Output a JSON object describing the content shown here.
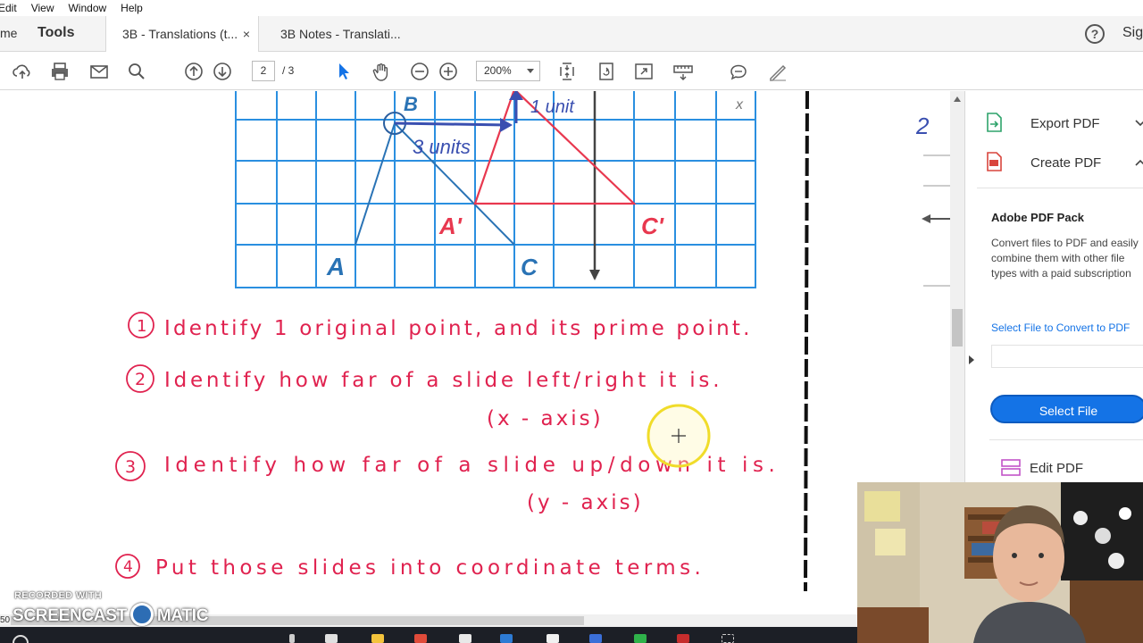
{
  "menu": {
    "items": [
      "Edit",
      "View",
      "Window",
      "Help"
    ]
  },
  "tabs": {
    "home_label": "me",
    "tools_label": "Tools",
    "doc_tabs": [
      {
        "label": "3B - Translations (t...",
        "close": "×"
      },
      {
        "label": "3B Notes - Translati..."
      }
    ],
    "help_glyph": "?",
    "sign_in_label": "Sig"
  },
  "toolbar": {
    "page_current": "2",
    "page_total": "/ 3",
    "zoom_value": "200%",
    "icons": [
      "cloud-upload-icon",
      "print-icon",
      "email-icon",
      "search-icon",
      "page-up-icon",
      "page-down-icon",
      "select-cursor-icon",
      "hand-tool-icon",
      "zoom-out-icon",
      "zoom-in-icon",
      "fit-page-icon",
      "rotate-icon",
      "full-screen-icon",
      "scroll-mode-icon",
      "comment-icon",
      "sign-icon"
    ]
  },
  "document": {
    "graph_labels": {
      "b": "B",
      "a": "A",
      "c": "C",
      "a_prime": "A'",
      "c_prime": "C'",
      "one_unit": "1 unit",
      "three_units": "3 units",
      "x": "x",
      "margin_note": "2"
    },
    "steps": [
      {
        "number": "1",
        "text": "Identify 1 original point, and its prime point."
      },
      {
        "number": "2",
        "text": "Identify how far of a slide left/right it is.",
        "sub": "(x - axis)"
      },
      {
        "number": "3",
        "text": "Identify how far of a slide up/down it is.",
        "sub": "(y - axis)"
      },
      {
        "number": "4",
        "text": "Put those slides into coordinate terms."
      }
    ],
    "colors": {
      "grid": "#2a8fe0",
      "handwriting": "#e0224f",
      "triangle_original": "#2a73b5",
      "triangle_prime": "#e8384f",
      "cursor_ring": "#f0dc2a"
    }
  },
  "right_pane": {
    "tools": [
      {
        "label": "Export PDF",
        "icon": "export-pdf-icon",
        "chevron": "chevron-down-icon"
      },
      {
        "label": "Create PDF",
        "icon": "create-pdf-icon",
        "chevron": "chevron-up-icon"
      }
    ],
    "pack_title": "Adobe PDF Pack",
    "pack_description": "Convert files to PDF and easily combine them with other file types with a paid subscription",
    "select_link": "Select File to Convert to PDF",
    "select_button": "Select File",
    "edit_pdf_label": "Edit PDF"
  },
  "overlay": {
    "watermark_top": "RECORDED WITH",
    "watermark_left": "SCREENCAST",
    "watermark_right": "MATIC",
    "zoom_note": "50"
  }
}
